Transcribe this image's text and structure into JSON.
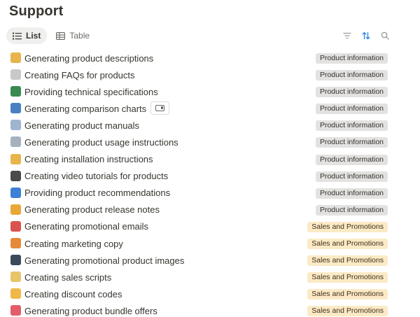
{
  "page": {
    "title": "Support"
  },
  "views": [
    {
      "label": "List",
      "icon": "list-icon",
      "active": true
    },
    {
      "label": "Table",
      "icon": "table-icon",
      "active": false
    }
  ],
  "toolbar": [
    {
      "icon": "filter-icon",
      "color": "#9b9a97"
    },
    {
      "icon": "sort-icon",
      "color": "#2383e2"
    },
    {
      "icon": "search-icon",
      "color": "#9b9a97"
    }
  ],
  "tag_colors": {
    "gray": "#e3e2e0",
    "yellow": "#fbeac5"
  },
  "rows": [
    {
      "title": "Generating product descriptions",
      "icon": "memo-icon",
      "icon_color": "#e8b44c",
      "tag": "Product information",
      "tag_style": "gray"
    },
    {
      "title": "Creating FAQs for products",
      "icon": "question-mark-icon",
      "icon_color": "#c9c9c9",
      "tag": "Product information",
      "tag_style": "gray"
    },
    {
      "title": "Providing technical specifications",
      "icon": "microchip-icon",
      "icon_color": "#3a8a52",
      "tag": "Product information",
      "tag_style": "gray"
    },
    {
      "title": "Generating comparison charts",
      "icon": "bar-chart-icon",
      "icon_color": "#4a7fc1",
      "tag": "Product information",
      "tag_style": "gray",
      "has_open_button": true
    },
    {
      "title": "Generating product manuals",
      "icon": "document-icon",
      "icon_color": "#9fb4cf",
      "tag": "Product information",
      "tag_style": "gray"
    },
    {
      "title": "Generating product usage instructions",
      "icon": "page-icon",
      "icon_color": "#a7b1bd",
      "tag": "Product information",
      "tag_style": "gray"
    },
    {
      "title": "Creating installation instructions",
      "icon": "memo-icon",
      "icon_color": "#e8b44c",
      "tag": "Product information",
      "tag_style": "gray"
    },
    {
      "title": "Creating video tutorials for products",
      "icon": "video-camera-icon",
      "icon_color": "#4a4a4a",
      "tag": "Product information",
      "tag_style": "gray"
    },
    {
      "title": "Providing product recommendations",
      "icon": "numbers-icon",
      "icon_color": "#3f7fd6",
      "tag": "Product information",
      "tag_style": "gray"
    },
    {
      "title": "Generating product release notes",
      "icon": "notebook-icon",
      "icon_color": "#e8a838",
      "tag": "Product information",
      "tag_style": "gray"
    },
    {
      "title": "Generating promotional emails",
      "icon": "outbox-tray-icon",
      "icon_color": "#d9534f",
      "tag": "Sales and Promotions",
      "tag_style": "yellow"
    },
    {
      "title": "Creating marketing copy",
      "icon": "pencil-icon",
      "icon_color": "#e58a3a",
      "tag": "Sales and Promotions",
      "tag_style": "yellow"
    },
    {
      "title": "Generating promotional product images",
      "icon": "camera-icon",
      "icon_color": "#3b4a5a",
      "tag": "Sales and Promotions",
      "tag_style": "yellow"
    },
    {
      "title": "Creating sales scripts",
      "icon": "scroll-icon",
      "icon_color": "#e9c46a",
      "tag": "Sales and Promotions",
      "tag_style": "yellow"
    },
    {
      "title": "Creating discount codes",
      "icon": "label-tag-icon",
      "icon_color": "#f0b74a",
      "tag": "Sales and Promotions",
      "tag_style": "yellow"
    },
    {
      "title": "Generating product bundle offers",
      "icon": "bundle-icon",
      "icon_color": "#e35d6a",
      "tag": "Sales and Promotions",
      "tag_style": "yellow"
    }
  ]
}
